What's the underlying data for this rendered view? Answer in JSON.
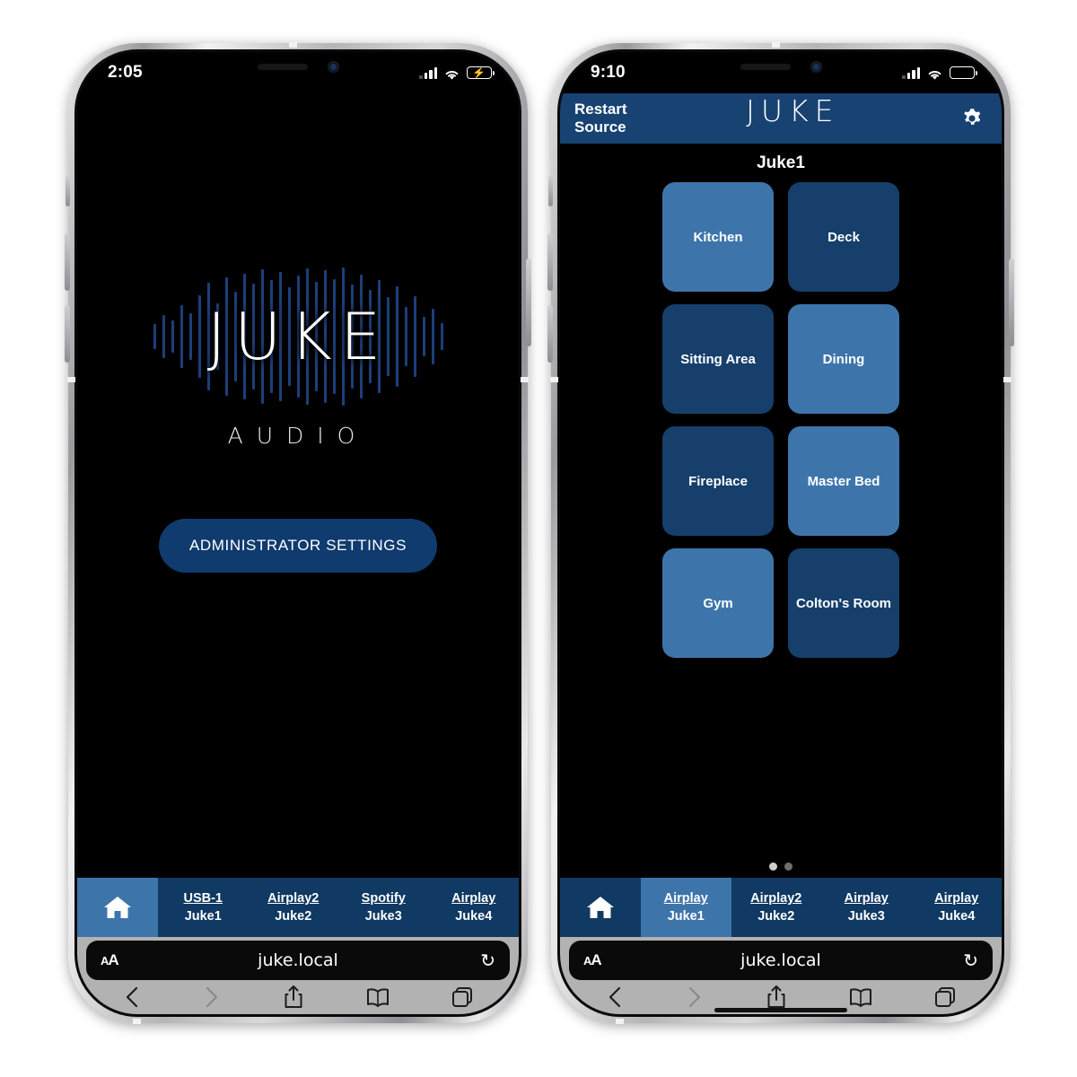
{
  "left_phone": {
    "status_bar": {
      "time": "2:05",
      "signal_icon": "cellular-signal-icon",
      "wifi_icon": "wifi-icon",
      "battery_icon": "battery-charging-icon",
      "battery_color": "#34c759",
      "battery_state": "charging"
    },
    "splash": {
      "logo_text": "JUKE",
      "logo_subtitle": "AUDIO",
      "admin_button_label": "ADMINISTRATOR SETTINGS",
      "admin_button_color": "#0f3b6e"
    },
    "source_nav": {
      "home_icon": "home-icon",
      "home_active": true,
      "items": [
        {
          "source": "USB-1",
          "device": "Juke1",
          "active": false
        },
        {
          "source": "Airplay2",
          "device": "Juke2",
          "active": false
        },
        {
          "source": "Spotify",
          "device": "Juke3",
          "active": false
        },
        {
          "source": "Airplay",
          "device": "Juke4",
          "active": false
        }
      ]
    },
    "safari": {
      "text_size_label": "AA",
      "url": "juke.local",
      "reload_icon": "reload-icon",
      "toolbar": [
        "back-icon",
        "forward-icon",
        "share-icon",
        "bookmarks-icon",
        "tabs-icon"
      ]
    }
  },
  "right_phone": {
    "status_bar": {
      "time": "9:10",
      "signal_icon": "cellular-signal-icon",
      "wifi_icon": "wifi-icon",
      "battery_icon": "battery-low-icon",
      "battery_color": "#ffcc00",
      "battery_state": "low"
    },
    "header": {
      "restart_line1": "Restart",
      "restart_line2": "Source",
      "title": "JUKE",
      "settings_icon": "gear-icon",
      "background_color": "#174272"
    },
    "device_name": "Juke1",
    "zone_colors": {
      "active": "#3d75ab",
      "inactive": "#163f6b"
    },
    "zones": [
      {
        "label": "Kitchen",
        "active": true
      },
      {
        "label": "Deck",
        "active": false
      },
      {
        "label": "Sitting Area",
        "active": false
      },
      {
        "label": "Dining",
        "active": true
      },
      {
        "label": "Fireplace",
        "active": false
      },
      {
        "label": "Master Bed",
        "active": true
      },
      {
        "label": "Gym",
        "active": true
      },
      {
        "label": "Colton's Room",
        "active": false
      }
    ],
    "page_dots": {
      "count": 2,
      "active_index": 0
    },
    "source_nav": {
      "home_icon": "home-icon",
      "home_active": false,
      "items": [
        {
          "source": "Airplay",
          "device": "Juke1",
          "active": true
        },
        {
          "source": "Airplay2",
          "device": "Juke2",
          "active": false
        },
        {
          "source": "Airplay",
          "device": "Juke3",
          "active": false
        },
        {
          "source": "Airplay",
          "device": "Juke4",
          "active": false
        }
      ]
    },
    "safari": {
      "text_size_label": "AA",
      "url": "juke.local",
      "reload_icon": "reload-icon",
      "toolbar": [
        "back-icon",
        "forward-icon",
        "share-icon",
        "bookmarks-icon",
        "tabs-icon"
      ]
    }
  }
}
